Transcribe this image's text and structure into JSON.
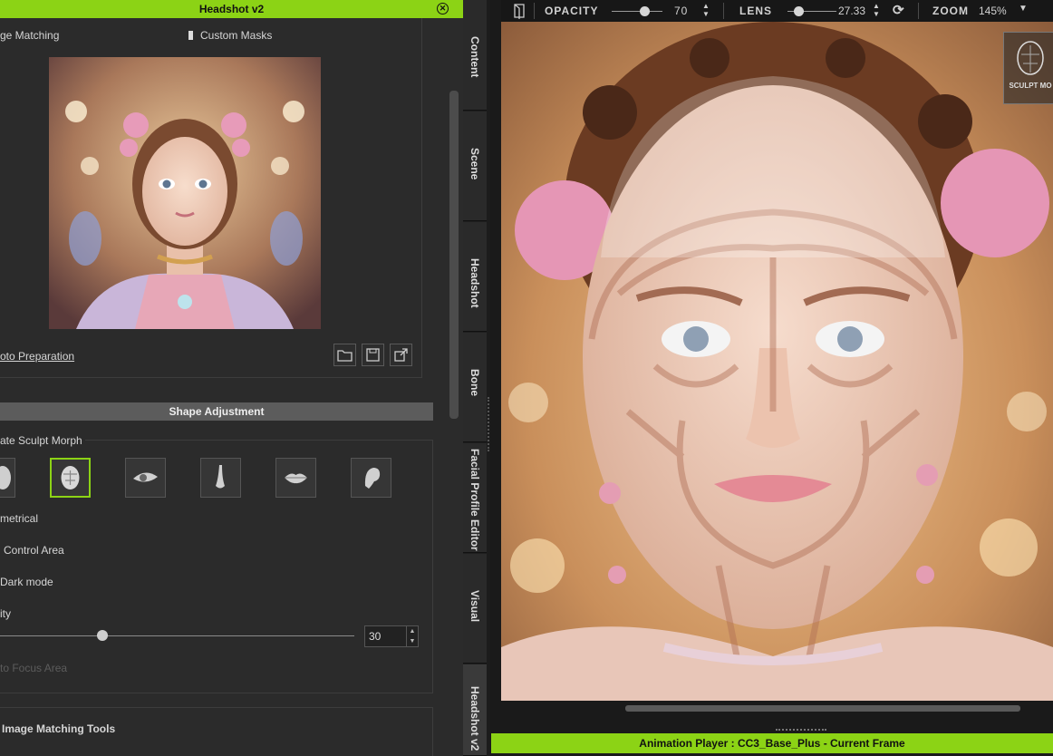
{
  "panel": {
    "title": "Headshot v2",
    "image_matching_label": "ge Matching",
    "custom_masks_label": "Custom Masks",
    "photo_prep_link": "oto Preparation"
  },
  "shape": {
    "header": "Shape Adjustment",
    "sculpt_morph_label": "ate Sculpt Morph",
    "symmetrical_label": "metrical",
    "control_area_label": "Control Area",
    "dark_mode_label": "Dark mode",
    "intensity_label": "ity",
    "intensity_value": "30",
    "intensity_fraction": 0.29,
    "focus_label": "to Focus Area",
    "parts": [
      {
        "icon": "head-icon",
        "name": "head"
      },
      {
        "icon": "face-icon",
        "name": "face"
      },
      {
        "icon": "eye-icon",
        "name": "eye"
      },
      {
        "icon": "nose-icon",
        "name": "nose"
      },
      {
        "icon": "lips-icon",
        "name": "lips"
      },
      {
        "icon": "ear-icon",
        "name": "ear"
      }
    ],
    "selected_part": "face"
  },
  "image_tools": {
    "label": "Image Matching Tools"
  },
  "tabs": [
    "Content",
    "Scene",
    "Headshot",
    "Bone",
    "Facial Profile Editor",
    "Visual",
    "Headshot v2"
  ],
  "active_tab": "Headshot v2",
  "viewport": {
    "opacity_label": "OPACITY",
    "opacity_value": "70",
    "lens_label": "LENS",
    "lens_value": "27.33",
    "zoom_label": "ZOOM",
    "zoom_value": "145%",
    "sculpt_mode_label": "SCULPT MO"
  },
  "status_bar": {
    "text": "Animation Player : CC3_Base_Plus - Current Frame"
  },
  "colors": {
    "accent": "#8cd315",
    "panel": "#2b2b2b",
    "section": "#5c5c5c"
  }
}
